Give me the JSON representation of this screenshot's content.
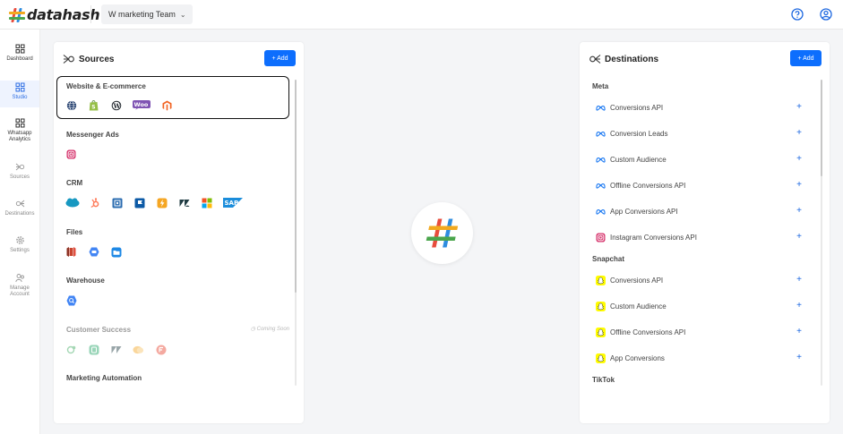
{
  "topbar": {
    "brand": "datahash",
    "team_select": "W marketing Team",
    "help_icon": "help-circle-icon",
    "account_icon": "user-circle-icon"
  },
  "sidebar": {
    "items": [
      {
        "label": "Dashboard",
        "icon": "grid-icon"
      },
      {
        "label": "Studio",
        "icon": "grid-icon"
      },
      {
        "label": "Whatsapp Analytics",
        "icon": "grid-icon"
      },
      {
        "label": "Sources",
        "icon": "sources-icon"
      },
      {
        "label": "Destinations",
        "icon": "destinations-icon"
      },
      {
        "label": "Settings",
        "icon": "gear-icon"
      },
      {
        "label": "Manage Account",
        "icon": "users-icon"
      }
    ]
  },
  "sources": {
    "title": "Sources",
    "add_label": "+ Add",
    "groups": [
      {
        "title": "Website & E-commerce",
        "icons": [
          "globe-icon",
          "shopify-icon",
          "wordpress-icon",
          "woocommerce-icon",
          "magento-icon"
        ]
      },
      {
        "title": "Messenger Ads",
        "icons": [
          "instagram-icon"
        ]
      },
      {
        "title": "CRM",
        "icons": [
          "salesforce-icon",
          "hubspot-icon",
          "crm-box-icon",
          "crm-flag-icon",
          "zoho-bolt-icon",
          "zendesk-icon",
          "windows-icon",
          "sap-icon"
        ]
      },
      {
        "title": "Files",
        "icons": [
          "s3-icon",
          "cloud-sql-icon",
          "folder-icon"
        ]
      },
      {
        "title": "Warehouse",
        "icons": [
          "bigquery-icon"
        ]
      },
      {
        "title": "Customer Success",
        "icons": [
          "cs-1-icon",
          "cs-2-icon",
          "zendesk-icon",
          "cs-4-icon",
          "cs-5-icon"
        ],
        "badge": "Coming Soon"
      },
      {
        "title": "Marketing Automation",
        "icons": []
      }
    ]
  },
  "destinations": {
    "title": "Destinations",
    "add_label": "+ Add",
    "sections": [
      {
        "title": "Meta",
        "items": [
          {
            "label": "Conversions API",
            "icon": "meta-icon"
          },
          {
            "label": "Conversion Leads",
            "icon": "meta-icon"
          },
          {
            "label": "Custom Audience",
            "icon": "meta-icon"
          },
          {
            "label": "Offline Conversions API",
            "icon": "meta-icon"
          },
          {
            "label": "App Conversions API",
            "icon": "meta-icon"
          },
          {
            "label": "Instagram Conversions API",
            "icon": "instagram-icon"
          }
        ]
      },
      {
        "title": "Snapchat",
        "items": [
          {
            "label": "Conversions API",
            "icon": "snapchat-icon"
          },
          {
            "label": "Custom Audience",
            "icon": "snapchat-icon"
          },
          {
            "label": "Offline Conversions API",
            "icon": "snapchat-icon"
          },
          {
            "label": "App Conversions",
            "icon": "snapchat-icon"
          }
        ]
      },
      {
        "title": "TikTok",
        "items": []
      }
    ],
    "plus_label": "+"
  },
  "colors": {
    "accent": "#0d6efd",
    "active_nav_bg": "#eef3fe",
    "active_nav_text": "#2f6fe4"
  }
}
